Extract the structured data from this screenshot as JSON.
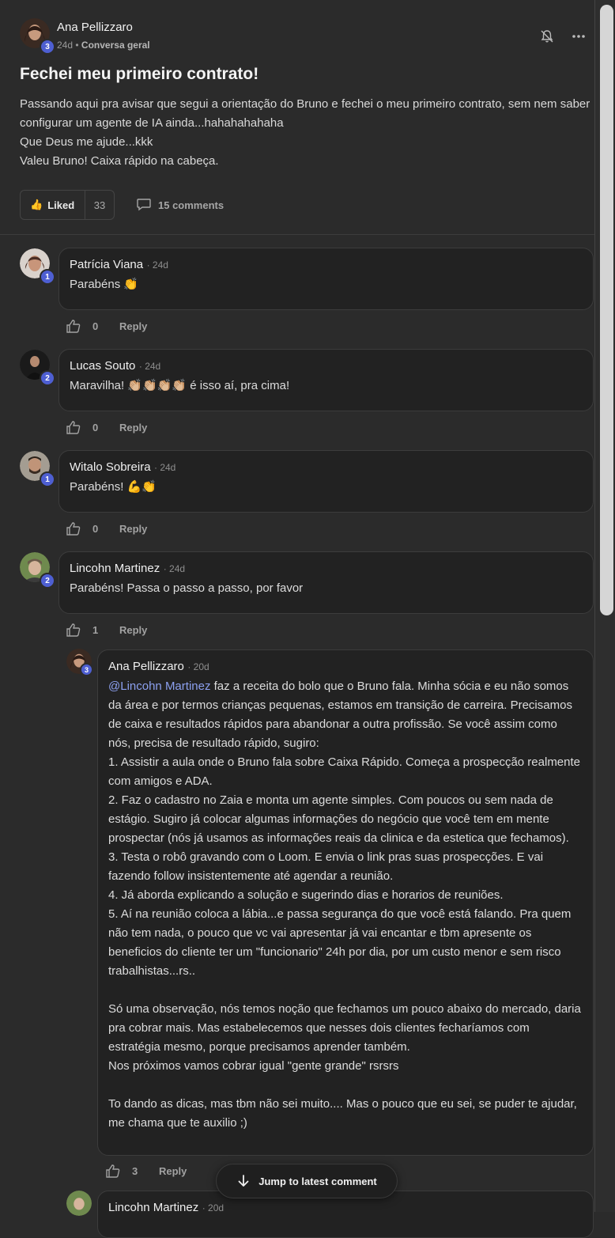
{
  "post": {
    "author": "Ana Pellizzaro",
    "author_level": "3",
    "time": "24d",
    "separator": "•",
    "channel": "Conversa geral",
    "title": "Fechei meu primeiro contrato!",
    "body": [
      "Passando aqui pra avisar que segui a orientação do Bruno e fechei o meu primeiro contrato, sem nem saber configurar um agente de IA ainda...hahahahahaha",
      "Que Deus me ajude...kkk",
      "Valeu Bruno! Caixa rápido na cabeça."
    ],
    "liked_label": "Liked",
    "like_count": "33",
    "comments_label": "15 comments"
  },
  "comments": [
    {
      "author": "Patrícia Viana",
      "level": "1",
      "time": "· 24d",
      "text": "Parabéns 👏",
      "likes": "0",
      "reply": "Reply",
      "avatar_color": "#7a5648"
    },
    {
      "author": "Lucas Souto",
      "level": "2",
      "time": "· 24d",
      "text": "Maravilha! 👏🏼👏🏼👏🏼👏🏼 é isso aí, pra cima!",
      "likes": "0",
      "reply": "Reply",
      "avatar_color": "#222222"
    },
    {
      "author": "Witalo Sobreira",
      "level": "1",
      "time": "· 24d",
      "text": "Parabéns! 💪👏",
      "likes": "0",
      "reply": "Reply",
      "avatar_color": "#8f8a80"
    },
    {
      "author": "Lincohn Martinez",
      "level": "2",
      "time": "· 24d",
      "text": "Parabéns! Passa o passo a passo, por favor",
      "likes": "1",
      "reply": "Reply",
      "avatar_color": "#5a7040"
    }
  ],
  "reply": {
    "author": "Ana Pellizzaro",
    "level": "3",
    "time": "· 20d",
    "mention": "@Lincohn Martinez",
    "first_line_rest": " faz a receita do bolo que o Bruno fala. Minha sócia e eu não somos da área e por termos crianças pequenas, estamos em transição de carreira. Precisamos de caixa e resultados rápidos para abandonar a outra profissão. Se você assim como nós, precisa de resultado rápido, sugiro:",
    "steps": [
      "1. Assistir a aula onde o Bruno fala sobre Caixa Rápido. Começa a prospecção realmente com amigos e ADA.",
      "2. Faz o cadastro no Zaia e monta um agente simples. Com poucos ou sem nada de estágio. Sugiro já colocar algumas informações do negócio que você tem em mente prospectar (nós já usamos as informações reais da clinica e da estetica que fechamos).",
      "3. Testa o robô gravando com o Loom. E envia o link pras suas prospecções. E vai fazendo follow insistentemente até agendar a reunião.",
      "4. Já aborda explicando a solução e sugerindo dias e horarios de reuniões.",
      "5. Aí na reunião coloca a lábia...e passa segurança do que você está falando. Pra quem não tem nada, o pouco que vc vai apresentar já vai encantar e tbm apresente os beneficios do cliente ter um \"funcionario\" 24h por dia, por um custo menor e sem risco trabalhistas...rs.."
    ],
    "para2": [
      "Só uma observação, nós temos noção que fechamos um pouco abaixo do mercado, daria pra cobrar mais. Mas estabelecemos que nesses dois clientes fecharíamos com estratégia mesmo, porque precisamos aprender também.",
      "Nos próximos vamos cobrar igual \"gente grande\" rsrsrs"
    ],
    "para3": "To dando as dicas, mas tbm não sei muito.... Mas o pouco que eu sei, se puder te ajudar, me chama que te auxilio ;)",
    "likes": "3",
    "reply_label": "Reply"
  },
  "next_comment": {
    "author": "Lincohn Martinez",
    "time": "· 20d"
  },
  "jump_label": "Jump to latest comment",
  "colors": {
    "accent": "#4e5fd2",
    "mention": "#8ca0ef",
    "background": "#2b2b2b"
  }
}
